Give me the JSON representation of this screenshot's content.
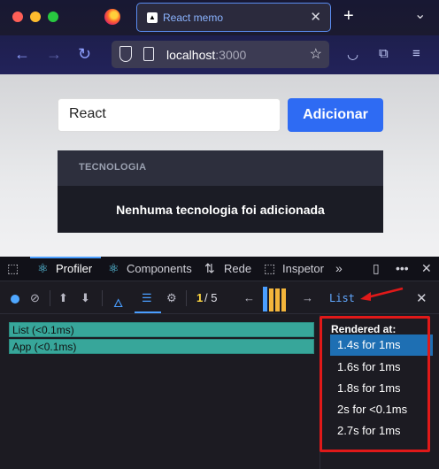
{
  "browser": {
    "tab_title": "React memo",
    "tab_favicon": "▲",
    "url_host": "localhost",
    "url_port": ":3000"
  },
  "page": {
    "input_value": "React",
    "add_button_label": "Adicionar",
    "card_header": "TECNOLOGIA",
    "empty_message": "Nenhuma tecnologia foi adicionada"
  },
  "devtools": {
    "tabs": [
      "Profiler",
      "Components",
      "Rede",
      "Inspetor"
    ],
    "commit_current": "1",
    "commit_total": " / 5",
    "selected_component": "List",
    "ranked_rows": [
      "List (<0.1ms)",
      "App (<0.1ms)"
    ],
    "rendered_at_label": "Rendered at:",
    "rendered_at": [
      "1.4s for 1ms",
      "1.6s for 1ms",
      "1.8s for 1ms",
      "2s for <0.1ms",
      "2.7s for 1ms"
    ],
    "commit_bar_colors": [
      "#4a9eff",
      "#f3b53b",
      "#f3b53b",
      "#f3b53b"
    ]
  },
  "colors": {
    "accent_blue": "#2e6bf3",
    "ranked_teal": "#37a69a",
    "annotation_red": "#e01919"
  }
}
